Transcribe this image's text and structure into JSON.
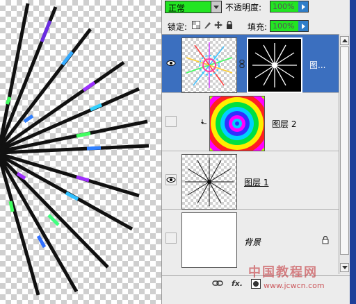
{
  "toolbar": {
    "blend_mode": "正常",
    "opacity_label": "不透明度:",
    "opacity_value": "100%",
    "lock_label": "锁定:",
    "fill_label": "填充:",
    "fill_value": "100%"
  },
  "layers": [
    {
      "name": "图...",
      "visible": true,
      "selected": true,
      "has_mask": true
    },
    {
      "name": "图层 2",
      "visible": false,
      "selected": false,
      "clipped": true
    },
    {
      "name": "图层 1",
      "visible": true,
      "selected": false
    },
    {
      "name": "背景",
      "visible": false,
      "selected": false,
      "locked": true
    }
  ],
  "bottom_bar": {
    "link_icon": "link-icon",
    "fx_label": "fx.",
    "mask_icon": "mask-icon"
  },
  "watermark": {
    "text": "中国教程网",
    "url": "www.jcwcn.com"
  },
  "colors": {
    "field_green": "#22e522",
    "selection_blue": "#3b6fbf"
  }
}
